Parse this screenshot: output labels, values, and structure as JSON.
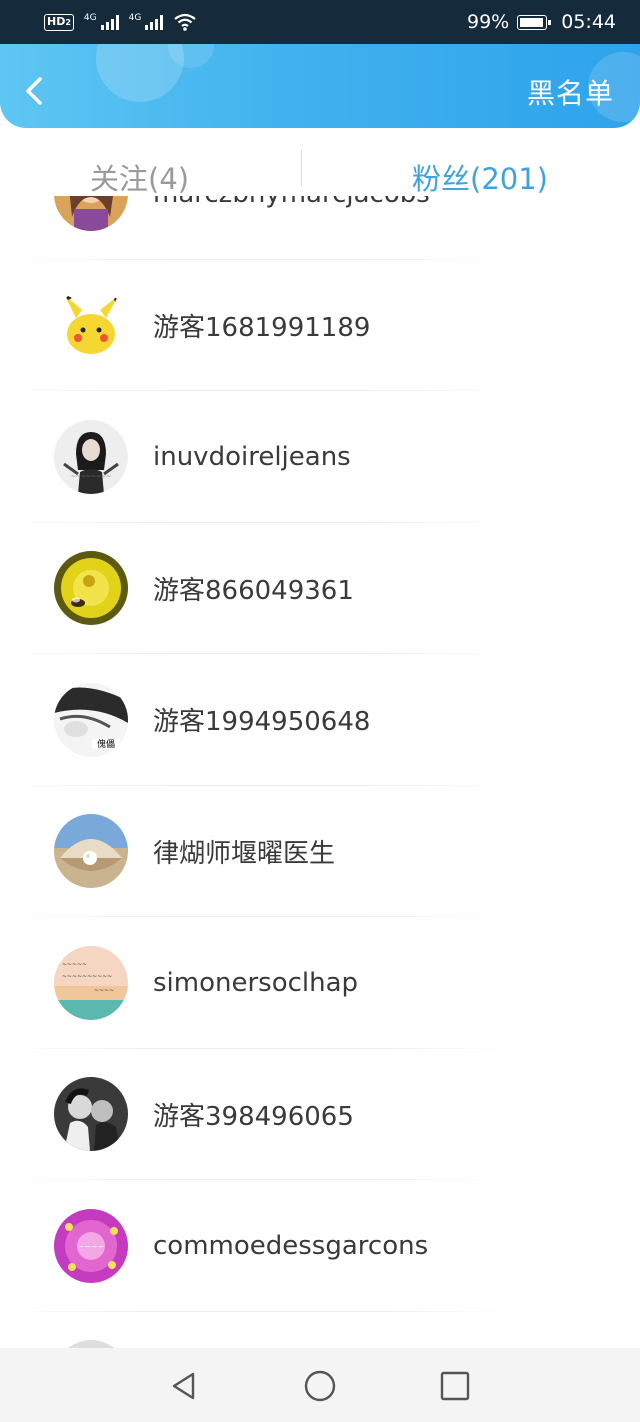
{
  "status_bar": {
    "hd_label": "HD",
    "hd_sub": "2",
    "network_label_1": "4G",
    "network_label_2": "4G",
    "battery_percent": "99%",
    "time": "05:44"
  },
  "header": {
    "back_icon": "chevron-left-icon",
    "blacklist_label": "黑名单",
    "gradient_start": "#5ec6f3",
    "gradient_end": "#2ea3eb"
  },
  "tabs": {
    "follow_label": "关注(4)",
    "fans_label": "粉丝(201)",
    "active_color": "#3fa3de",
    "inactive_color": "#9a9a9a"
  },
  "fans": [
    {
      "name": "marczbhymarcjacobs",
      "avatar": "anime-girl-avatar"
    },
    {
      "name": "游客1681991189",
      "avatar": "pikachu-avatar"
    },
    {
      "name": "inuvdoireljeans",
      "avatar": "woman-bw-avatar"
    },
    {
      "name": "游客866049361",
      "avatar": "yellow-flower-bee-avatar"
    },
    {
      "name": "游客1994950648",
      "avatar": "bw-hair-text-avatar"
    },
    {
      "name": "律煳师堰曜医生",
      "avatar": "pearl-shell-avatar"
    },
    {
      "name": "simonersoclhap",
      "avatar": "sunset-text-avatar"
    },
    {
      "name": "游客398496065",
      "avatar": "couple-bw-avatar"
    },
    {
      "name": "commoedessgarcons",
      "avatar": "pink-love-avatar"
    },
    {
      "name": "",
      "avatar": "partial-avatar"
    }
  ],
  "nav": {
    "back_icon": "triangle-back-icon",
    "home_icon": "circle-home-icon",
    "recent_icon": "square-recent-icon"
  }
}
